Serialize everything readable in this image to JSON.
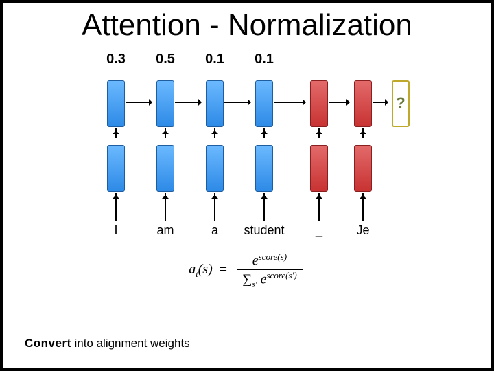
{
  "title": "Attention - Normalization",
  "weights": [
    "0.3",
    "0.5",
    "0.1",
    "0.1"
  ],
  "tokens": [
    "I",
    "am",
    "a",
    "student",
    "_",
    "Je"
  ],
  "question": "?",
  "formula": {
    "lhs_var": "a",
    "lhs_sub": "t",
    "lhs_arg": "s",
    "eq": "=",
    "num_base": "e",
    "num_exp": "score(s)",
    "den_sum": "∑",
    "den_sub": "s′",
    "den_base": "e",
    "den_exp": "score(s′)"
  },
  "caption_bold": "Convert",
  "caption_rest": " into alignment weights"
}
